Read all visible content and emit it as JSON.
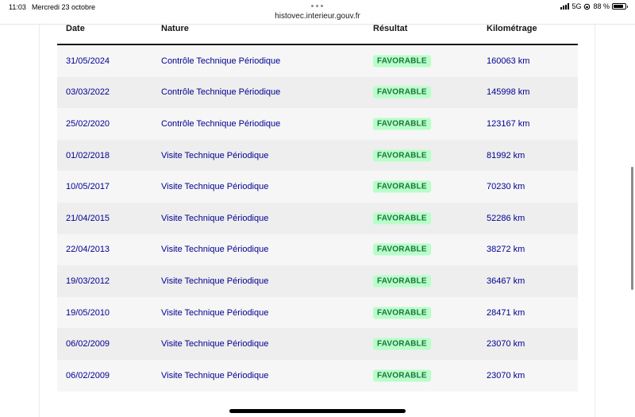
{
  "status_bar": {
    "time": "11:03",
    "date": "Mercredi 23 octobre",
    "network": "5G",
    "battery": "88 %",
    "battery_level": 0.88
  },
  "browser": {
    "url": "histovec.interieur.gouv.fr"
  },
  "table": {
    "headers": {
      "date": "Date",
      "nature": "Nature",
      "result": "Résultat",
      "km": "Kilométrage"
    },
    "rows": [
      {
        "date": "31/05/2024",
        "nature": "Contrôle Technique Périodique",
        "result": "FAVORABLE",
        "km": "160063 km"
      },
      {
        "date": "03/03/2022",
        "nature": "Contrôle Technique Périodique",
        "result": "FAVORABLE",
        "km": "145998 km"
      },
      {
        "date": "25/02/2020",
        "nature": "Contrôle Technique Périodique",
        "result": "FAVORABLE",
        "km": "123167 km"
      },
      {
        "date": "01/02/2018",
        "nature": "Visite Technique Périodique",
        "result": "FAVORABLE",
        "km": "81992 km"
      },
      {
        "date": "10/05/2017",
        "nature": "Visite Technique Périodique",
        "result": "FAVORABLE",
        "km": "70230 km"
      },
      {
        "date": "21/04/2015",
        "nature": "Visite Technique Périodique",
        "result": "FAVORABLE",
        "km": "52286 km"
      },
      {
        "date": "22/04/2013",
        "nature": "Visite Technique Périodique",
        "result": "FAVORABLE",
        "km": "38272 km"
      },
      {
        "date": "19/03/2012",
        "nature": "Visite Technique Périodique",
        "result": "FAVORABLE",
        "km": "36467 km"
      },
      {
        "date": "19/05/2010",
        "nature": "Visite Technique Périodique",
        "result": "FAVORABLE",
        "km": "28471 km"
      },
      {
        "date": "06/02/2009",
        "nature": "Visite Technique Périodique",
        "result": "FAVORABLE",
        "km": "23070 km"
      },
      {
        "date": "06/02/2009",
        "nature": "Visite Technique Périodique",
        "result": "FAVORABLE",
        "km": "23070 km"
      }
    ]
  },
  "colors": {
    "link_blue": "#000091",
    "badge_bg": "#b8fec9",
    "badge_text": "#18753c",
    "row_light": "#f6f6f6",
    "row_dark": "#eeeeee"
  }
}
